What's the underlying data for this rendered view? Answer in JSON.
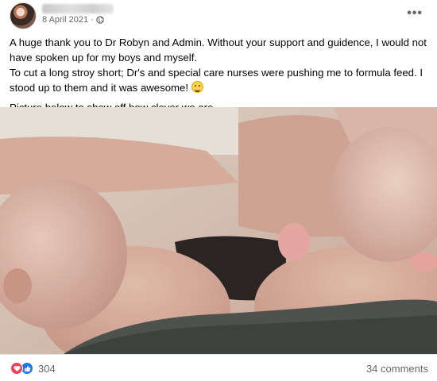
{
  "post": {
    "author_name": "Amanda Everett",
    "date": "8 April 2021",
    "separator": "·",
    "privacy_icon": "globe-icon",
    "more_icon": "more-options-icon",
    "text": {
      "line1": "A huge thank you to Dr Robyn and Admin. Without your support and guidence, I would not have spoken up for my boys and myself.",
      "line2": " To cut a long stroy short; Dr's and special care nurses were pushing me to formula feed. I stood up to them and it was awesome! ",
      "line3": "Picture below to show off how clever we are."
    },
    "emoji": "grinning-face-emoji"
  },
  "footer": {
    "reaction_icons": [
      "love-reaction-icon",
      "like-reaction-icon"
    ],
    "reaction_count": "304",
    "comments": "34 comments"
  },
  "colors": {
    "secondary_text": "#65676b",
    "love": "#f33e58",
    "like": "#1877f2"
  }
}
